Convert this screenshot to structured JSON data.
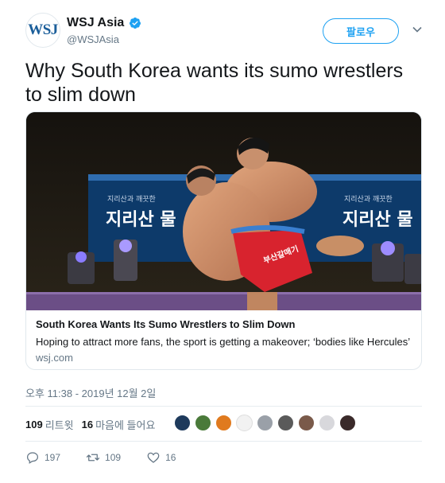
{
  "account": {
    "avatar_text": "WSJ",
    "display_name": "WSJ Asia",
    "handle": "@WSJAsia",
    "follow_label": "팔로우"
  },
  "tweet": {
    "text": "Why South Korea wants its sumo wrestlers to slim down",
    "timestamp": "오후 11:38 - 2019년 12월 2일"
  },
  "card": {
    "title": "South Korea Wants Its Sumo Wrestlers to Slim Down",
    "description": "Hoping to attract more fans, the sport is getting a makeover; ‘bodies like Hercules’",
    "domain": "wsj.com",
    "banner_text_left": "지리산 물",
    "banner_text_right": "지리산 물",
    "banner_small_left": "지리산과 깨끗한",
    "banner_small_right": "지리산과 깨끗한",
    "trunks_text": "부산갈매기"
  },
  "stats": {
    "retweet_count": "109",
    "retweet_label": "리트윗",
    "like_count": "16",
    "like_label": "마음에 들어요"
  },
  "actions": {
    "reply_count": "197",
    "retweet_count": "109",
    "like_count": "16"
  },
  "colors": {
    "accent": "#1da1f2",
    "secondary_text": "#657786",
    "border": "#e1e8ed"
  }
}
